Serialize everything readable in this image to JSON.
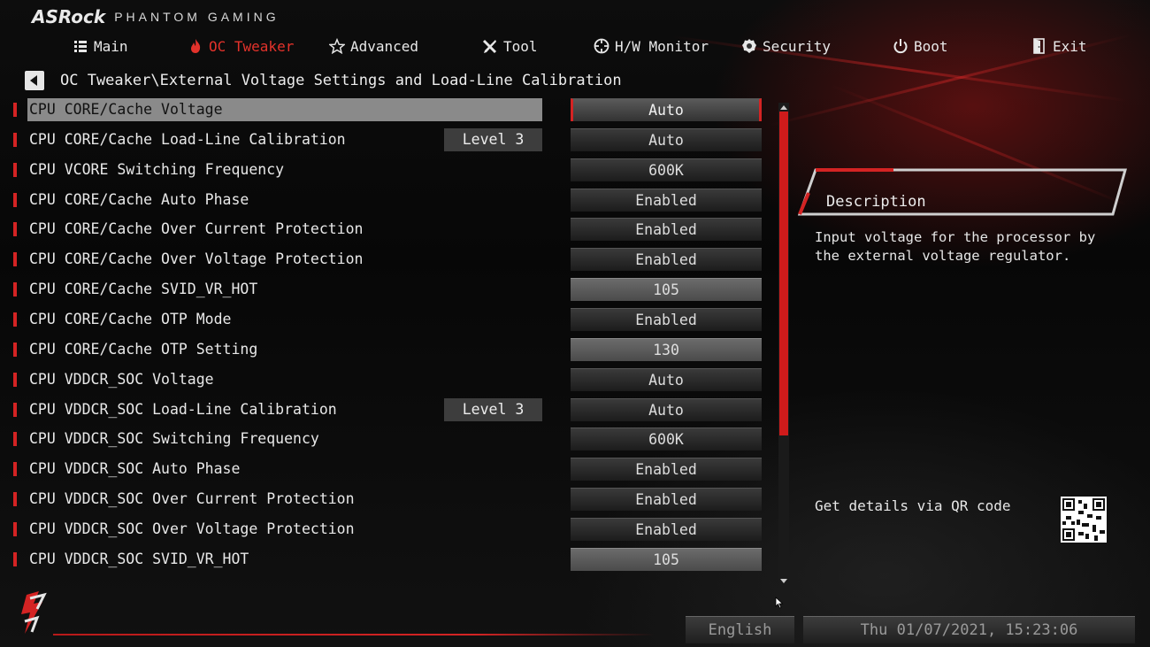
{
  "brand": {
    "logo": "ASRock",
    "subtitle": "PHANTOM GAMING"
  },
  "nav": [
    {
      "label": "Main",
      "icon": "list-icon",
      "active": false
    },
    {
      "label": "OC Tweaker",
      "icon": "flame-icon",
      "active": true
    },
    {
      "label": "Advanced",
      "icon": "star-icon",
      "active": false
    },
    {
      "label": "Tool",
      "icon": "tools-icon",
      "active": false
    },
    {
      "label": "H/W Monitor",
      "icon": "crosshair-icon",
      "active": false
    },
    {
      "label": "Security",
      "icon": "shield-icon",
      "active": false
    },
    {
      "label": "Boot",
      "icon": "power-icon",
      "active": false
    },
    {
      "label": "Exit",
      "icon": "exit-door-icon",
      "active": false
    }
  ],
  "breadcrumb": "OC Tweaker\\External Voltage Settings and Load-Line Calibration",
  "settings": [
    {
      "label": "CPU CORE/Cache Voltage",
      "level": "",
      "value": "Auto",
      "kind": "select",
      "selected": true
    },
    {
      "label": "CPU CORE/Cache Load-Line Calibration",
      "level": "Level 3",
      "value": "Auto",
      "kind": "select"
    },
    {
      "label": "CPU VCORE Switching Frequency",
      "level": "",
      "value": "600K",
      "kind": "select"
    },
    {
      "label": "CPU CORE/Cache Auto Phase",
      "level": "",
      "value": "Enabled",
      "kind": "select"
    },
    {
      "label": "CPU CORE/Cache Over Current Protection",
      "level": "",
      "value": "Enabled",
      "kind": "select"
    },
    {
      "label": "CPU CORE/Cache Over Voltage Protection",
      "level": "",
      "value": "Enabled",
      "kind": "select"
    },
    {
      "label": "CPU CORE/Cache SVID_VR_HOT",
      "level": "",
      "value": "105",
      "kind": "input"
    },
    {
      "label": "CPU CORE/Cache OTP Mode",
      "level": "",
      "value": "Enabled",
      "kind": "select"
    },
    {
      "label": "CPU CORE/Cache OTP Setting",
      "level": "",
      "value": "130",
      "kind": "input"
    },
    {
      "label": "CPU VDDCR_SOC Voltage",
      "level": "",
      "value": "Auto",
      "kind": "select"
    },
    {
      "label": "CPU VDDCR_SOC Load-Line Calibration",
      "level": "Level 3",
      "value": "Auto",
      "kind": "select"
    },
    {
      "label": "CPU VDDCR_SOC Switching Frequency",
      "level": "",
      "value": "600K",
      "kind": "select"
    },
    {
      "label": "CPU VDDCR_SOC Auto Phase",
      "level": "",
      "value": "Enabled",
      "kind": "select"
    },
    {
      "label": "CPU VDDCR_SOC Over Current Protection",
      "level": "",
      "value": "Enabled",
      "kind": "select"
    },
    {
      "label": "CPU VDDCR_SOC Over Voltage Protection",
      "level": "",
      "value": "Enabled",
      "kind": "select"
    },
    {
      "label": "CPU VDDCR_SOC SVID_VR_HOT",
      "level": "",
      "value": "105",
      "kind": "input"
    }
  ],
  "description": {
    "title": "Description",
    "text": "Input voltage for the processor by the external voltage regulator.",
    "qr_label": "Get details via QR code"
  },
  "footer": {
    "language": "English",
    "datetime": "Thu 01/07/2021, 15:23:06"
  },
  "colors": {
    "accent": "#d42323",
    "selected_row": "#8a8a8a"
  }
}
